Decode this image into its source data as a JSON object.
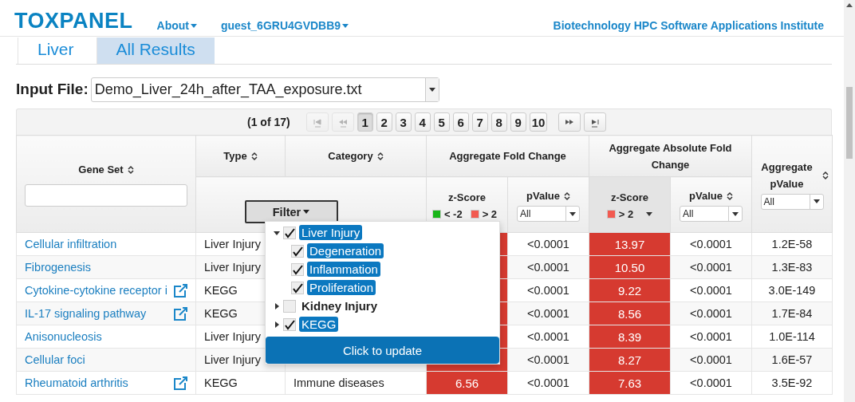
{
  "header": {
    "logo": "TOXPANEL",
    "menus": [
      {
        "label": "About"
      },
      {
        "label": "guest_6GRU4GVDBB9"
      }
    ],
    "institute": "Biotechnology HPC Software Applications Institute"
  },
  "tabs": [
    {
      "label": "Liver",
      "selected": false
    },
    {
      "label": "All Results",
      "selected": true
    }
  ],
  "input_file": {
    "label": "Input File:",
    "value": "Demo_Liver_24h_after_TAA_exposure.txt"
  },
  "pager": {
    "summary": "(1 of 17)",
    "buttons": [
      {
        "kind": "first",
        "selected": false,
        "disabled": true
      },
      {
        "kind": "prev",
        "selected": false,
        "disabled": true
      },
      {
        "kind": "page",
        "label": "1",
        "selected": true,
        "disabled": false
      },
      {
        "kind": "page",
        "label": "2",
        "selected": false,
        "disabled": false
      },
      {
        "kind": "page",
        "label": "3",
        "selected": false,
        "disabled": false
      },
      {
        "kind": "page",
        "label": "4",
        "selected": false,
        "disabled": false
      },
      {
        "kind": "page",
        "label": "5",
        "selected": false,
        "disabled": false
      },
      {
        "kind": "page",
        "label": "6",
        "selected": false,
        "disabled": false
      },
      {
        "kind": "page",
        "label": "7",
        "selected": false,
        "disabled": false
      },
      {
        "kind": "page",
        "label": "8",
        "selected": false,
        "disabled": false
      },
      {
        "kind": "page",
        "label": "9",
        "selected": false,
        "disabled": false
      },
      {
        "kind": "page",
        "label": "10",
        "selected": false,
        "disabled": false
      },
      {
        "kind": "next",
        "selected": false,
        "disabled": false
      },
      {
        "kind": "last",
        "selected": false,
        "disabled": false
      }
    ]
  },
  "table": {
    "headers": {
      "gene_set": "Gene Set",
      "type": "Type",
      "category": "Category",
      "filter_button": "Filter",
      "fold_group": "Aggregate Fold Change",
      "abs_group": "Aggregate Absolute Fold Change",
      "agg_pvalue": "Aggregate pValue",
      "agg_select": "All",
      "fold_z": {
        "title": "z-Score",
        "active": false,
        "legend": [
          {
            "color": "#19b619",
            "label": "< -2"
          },
          {
            "color": "#f25a50",
            "label": "> 2"
          }
        ]
      },
      "fold_p": {
        "title": "pValue",
        "select": "All"
      },
      "abs_z": {
        "title": "z-Score",
        "active": true,
        "legend": [
          {
            "color": "#f25a50",
            "label": "> 2"
          }
        ]
      },
      "abs_p": {
        "title": "pValue",
        "select": "All"
      }
    },
    "rows": [
      {
        "gene_set": "Cellular infiltration",
        "external": false,
        "type": "Liver Injury",
        "fold_z": {
          "high": true
        },
        "fold_p": "<0.0001",
        "abs_z": {
          "text": "13.97",
          "high": true
        },
        "abs_p": "<0.0001",
        "agg_p": "1.2E-58"
      },
      {
        "gene_set": "Fibrogenesis",
        "external": false,
        "type": "Liver Injury",
        "fold_z": {
          "high": true
        },
        "fold_p": "<0.0001",
        "abs_z": {
          "text": "10.50",
          "high": true
        },
        "abs_p": "<0.0001",
        "agg_p": "1.3E-83"
      },
      {
        "gene_set": "Cytokine-cytokine receptor i",
        "external": true,
        "type": "KEGG",
        "fold_z": {
          "high": true
        },
        "fold_p": "<0.0001",
        "abs_z": {
          "text": "9.22",
          "high": true
        },
        "abs_p": "<0.0001",
        "agg_p": "3.0E-149"
      },
      {
        "gene_set": "IL-17 signaling pathway",
        "external": true,
        "type": "KEGG",
        "fold_z": {
          "high": true
        },
        "fold_p": "<0.0001",
        "abs_z": {
          "text": "8.56",
          "high": true
        },
        "abs_p": "<0.0001",
        "agg_p": "1.7E-84"
      },
      {
        "gene_set": "Anisonucleosis",
        "external": false,
        "type": "Liver Injury",
        "fold_z": {
          "high": true
        },
        "fold_p": "<0.0001",
        "abs_z": {
          "text": "8.39",
          "high": true
        },
        "abs_p": "<0.0001",
        "agg_p": "1.0E-114"
      },
      {
        "gene_set": "Cellular foci",
        "external": false,
        "type": "Liver Injury",
        "fold_z": {
          "high": true
        },
        "fold_p": "<0.0001",
        "abs_z": {
          "text": "8.27",
          "high": true
        },
        "abs_p": "<0.0001",
        "agg_p": "1.6E-57"
      },
      {
        "gene_set": "Rheumatoid arthritis",
        "external": true,
        "type": "KEGG",
        "category": "Immune diseases",
        "fold_z": {
          "text": "6.56",
          "high": true
        },
        "fold_p": "<0.0001",
        "abs_z": {
          "text": "7.63",
          "high": true
        },
        "abs_p": "<0.0001",
        "agg_p": "3.5E-92"
      }
    ]
  },
  "filter_menu": {
    "items": [
      {
        "label": "Liver Injury",
        "checked": true,
        "expanded": true,
        "children": [
          {
            "label": "Degeneration",
            "checked": true
          },
          {
            "label": "Inflammation",
            "checked": true
          },
          {
            "label": "Proliferation",
            "checked": true
          }
        ]
      },
      {
        "label": "Kidney Injury",
        "checked": false,
        "expanded": false
      },
      {
        "label": "KEGG",
        "checked": true,
        "expanded": false
      }
    ],
    "update_button": "Click to update"
  }
}
